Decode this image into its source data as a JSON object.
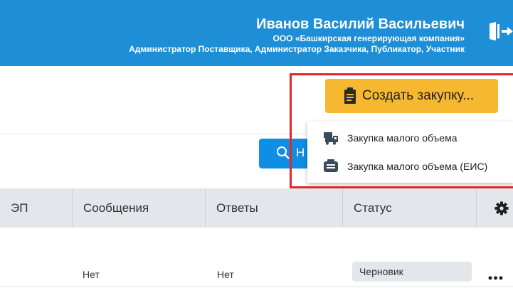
{
  "header": {
    "user_name": "Иванов Василий Васильевич",
    "organization": "ООО «Башкирская генерирующая компания»",
    "roles": "Администратор Поставщика, Администратор Заказчика, Публикатор, Участник",
    "exit_icon": "logout-door-icon",
    "background_color": "#1e8fd6"
  },
  "search": {
    "button_label_visible": "Н",
    "icon": "search-icon"
  },
  "create_purchase": {
    "label": "Создать закупку...",
    "icon": "clipboard-icon",
    "color": "#f5b830"
  },
  "create_menu": {
    "items": [
      {
        "label": "Закупка малого объема",
        "icon": "truck-box-icon"
      },
      {
        "label": "Закупка малого объема (ЕИС)",
        "icon": "eis-register-icon"
      }
    ]
  },
  "table": {
    "columns": [
      "ЭП",
      "Сообщения",
      "Ответы",
      "Статус"
    ],
    "settings_icon": "gear-icon",
    "rows": [
      {
        "messages": "Нет",
        "answers": "Нет",
        "status": "Черновик",
        "actions_icon": "more-dots-icon"
      }
    ]
  },
  "colors": {
    "highlight": "#e5242b",
    "table_header": "#e3e6ea",
    "primary": "#0e8ee4"
  }
}
